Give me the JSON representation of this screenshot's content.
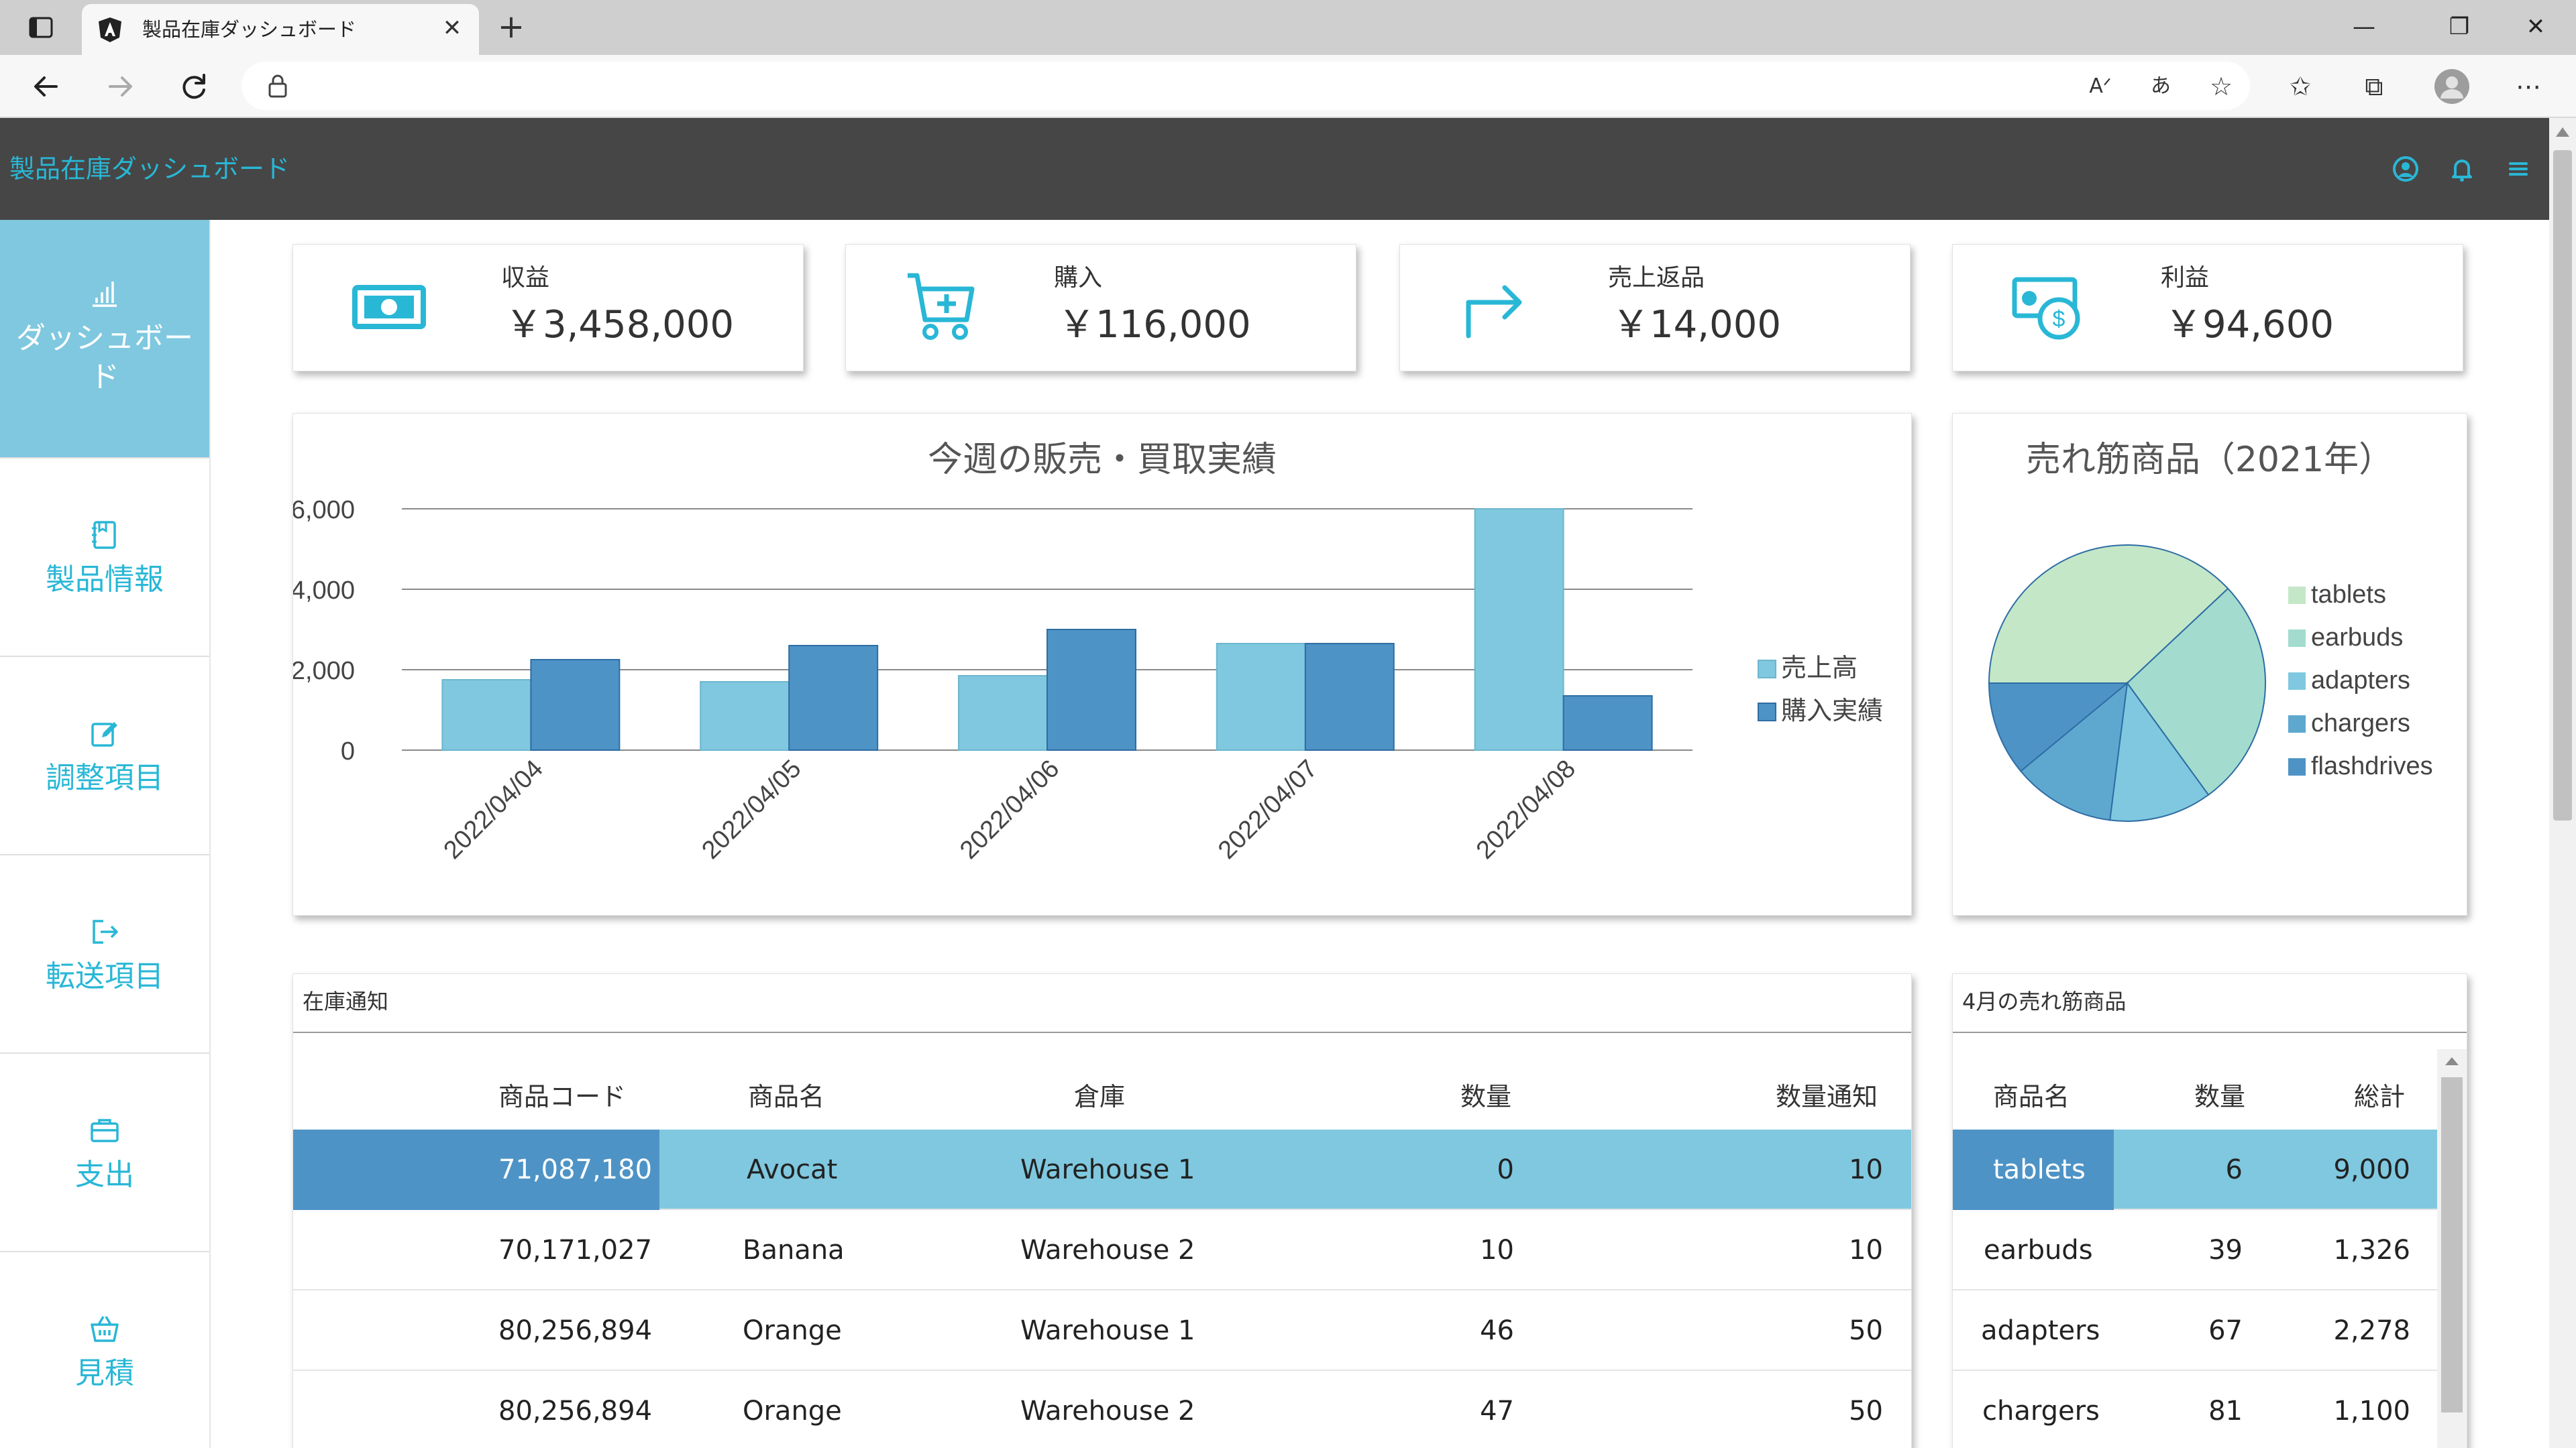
{
  "browser": {
    "tab_title": "製品在庫ダッシュボード",
    "close_tab": "✕",
    "new_tab": "+"
  },
  "app": {
    "title": "製品在庫ダッシュボード"
  },
  "sidebar": {
    "items": [
      {
        "label": "ダッシュボード",
        "icon": "bar-chart-icon",
        "active": true
      },
      {
        "label": "製品情報",
        "icon": "notebook-icon"
      },
      {
        "label": "調整項目",
        "icon": "edit-icon"
      },
      {
        "label": "転送項目",
        "icon": "logout-icon"
      },
      {
        "label": "支出",
        "icon": "wallet-icon"
      },
      {
        "label": "見積",
        "icon": "basket-icon"
      }
    ]
  },
  "kpis": [
    {
      "label": "収益",
      "value": "￥3,458,000",
      "icon": "cash-icon"
    },
    {
      "label": "購入",
      "value": "￥116,000",
      "icon": "cart-plus-icon"
    },
    {
      "label": "売上返品",
      "value": "￥14,000",
      "icon": "return-arrow-icon"
    },
    {
      "label": "利益",
      "value": "￥94,600",
      "icon": "money-dollar-icon"
    }
  ],
  "colors": {
    "accent": "#29b7d6",
    "header_bg": "#464646",
    "series_sales": "#7fc8df",
    "series_purchase": "#4e93c6",
    "selected_row": "#7fc8df",
    "selected_cell": "#4e93c6"
  },
  "chart_data": [
    {
      "type": "bar",
      "title": "今週の販売・買取実績",
      "categories": [
        "2022/04/04",
        "2022/04/05",
        "2022/04/06",
        "2022/04/07",
        "2022/04/08"
      ],
      "series": [
        {
          "name": "売上高",
          "values": [
            1750,
            1700,
            1850,
            2650,
            6000
          ]
        },
        {
          "name": "購入実績",
          "values": [
            2250,
            2600,
            3000,
            2650,
            1350
          ]
        }
      ],
      "yticks": [
        "0",
        "2,000",
        "4,000",
        "6,000"
      ],
      "ylim": [
        0,
        6000
      ],
      "legend": "right"
    },
    {
      "type": "pie",
      "title": "売れ筋商品（2021年）",
      "labels": [
        "tablets",
        "earbuds",
        "adapters",
        "chargers",
        "flashdrives"
      ],
      "values": [
        38,
        27,
        12,
        12,
        11
      ],
      "legend": "right"
    }
  ],
  "inventory": {
    "title": "在庫通知",
    "columns": [
      "商品コード",
      "商品名",
      "倉庫",
      "数量",
      "数量通知"
    ],
    "rows": [
      [
        "71,087,180",
        "Avocat",
        "Warehouse 1",
        "0",
        "10"
      ],
      [
        "70,171,027",
        "Banana",
        "Warehouse 2",
        "10",
        "10"
      ],
      [
        "80,256,894",
        "Orange",
        "Warehouse 1",
        "46",
        "50"
      ],
      [
        "80,256,894",
        "Orange",
        "Warehouse 2",
        "47",
        "50"
      ]
    ]
  },
  "bestsellers": {
    "title": "4月の売れ筋商品",
    "columns": [
      "商品名",
      "数量",
      "総計"
    ],
    "rows": [
      [
        "tablets",
        "6",
        "9,000"
      ],
      [
        "earbuds",
        "39",
        "1,326"
      ],
      [
        "adapters",
        "67",
        "2,278"
      ],
      [
        "chargers",
        "81",
        "1,100"
      ]
    ]
  }
}
